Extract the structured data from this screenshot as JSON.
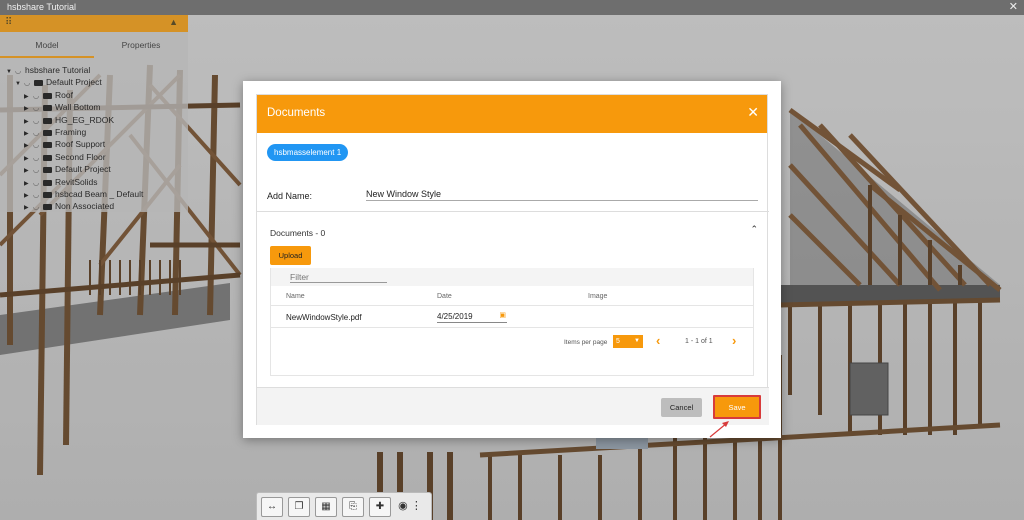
{
  "window": {
    "title": "hsbshare Tutorial",
    "close_icon": "close-icon"
  },
  "panel": {
    "tabs": [
      {
        "label": "Model",
        "active": true
      },
      {
        "label": "Properties",
        "active": false
      }
    ],
    "tree": {
      "root": "hsbshare Tutorial",
      "project": "Default Project",
      "items": [
        "Roof",
        "Wall Bottom",
        "HG_EG_RDOK",
        "Framing",
        "Roof Support",
        "Second Floor",
        "Default Project",
        "RevitSolids",
        "hsbcad Beam _ Default",
        "Non Associated"
      ]
    }
  },
  "modal": {
    "title": "Documents",
    "chip": "hsbmasselement 1",
    "add_name_label": "Add Name:",
    "add_name_value": "New Window Style",
    "section_title": "Documents - 0",
    "upload_label": "Upload",
    "filter_placeholder": "Filter",
    "columns": [
      "Name",
      "Date",
      "Image"
    ],
    "rows": [
      {
        "name": "NewWindowStyle.pdf",
        "date": "4/25/2019"
      }
    ],
    "pager": {
      "items_per_page_label": "Items per page",
      "items_per_page": "5",
      "range": "1 - 1 of 1"
    },
    "cancel_label": "Cancel",
    "save_label": "Save"
  },
  "colors": {
    "accent": "#f7990c",
    "chip": "#2196f3",
    "highlight": "#d83b3b"
  },
  "toolbar": {
    "icons": [
      "measure-icon",
      "layers-icon",
      "select-area-icon",
      "add-document-icon",
      "add-file-icon",
      "eye-icon",
      "more-icon"
    ]
  }
}
